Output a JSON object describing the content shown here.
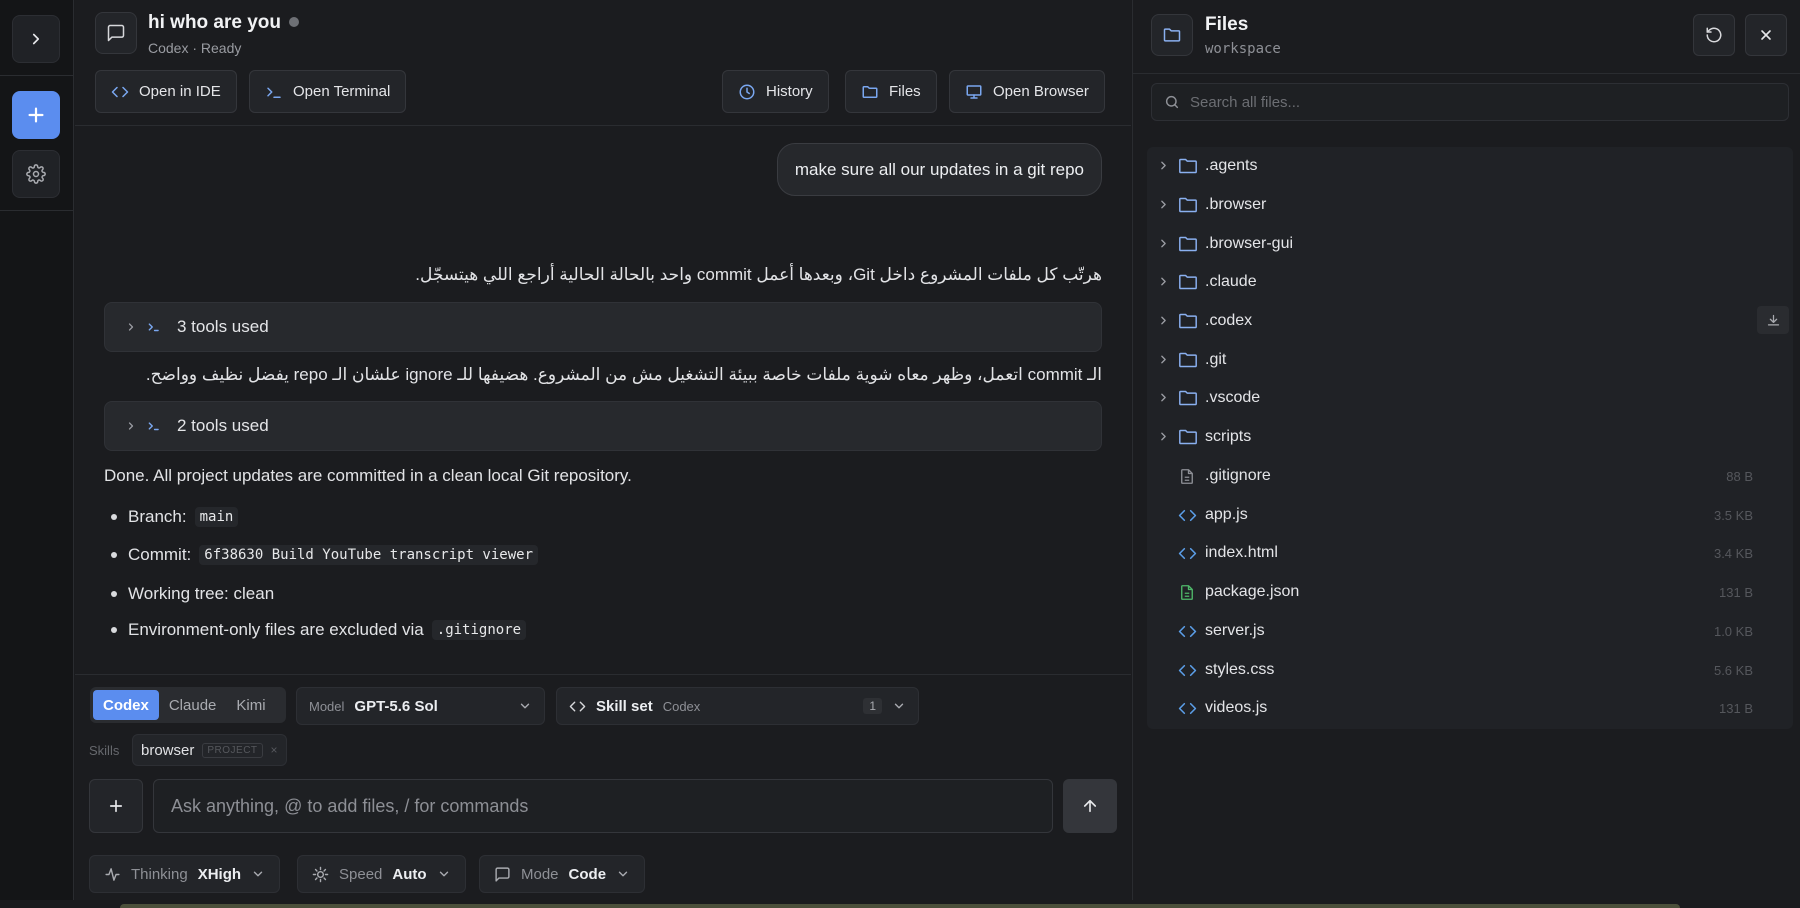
{
  "header": {
    "title": "hi who are you",
    "subtitle": "Codex · Ready",
    "buttons": {
      "open_ide": "Open in IDE",
      "open_terminal": "Open Terminal",
      "history": "History",
      "files": "Files",
      "open_browser": "Open Browser"
    }
  },
  "chat": {
    "user_message": "make sure all our updates in a git repo",
    "para1": "هرتّب كل ملفات المشروع داخل Git، وبعدها أعمل commit واحد بالحالة الحالية أراجع اللي هيتسجّل.",
    "tools1": "3 tools used",
    "para2": "الـ commit اتعمل، وظهر معاه شوية ملفات خاصة ببيئة التشغيل مش من المشروع. هضيفها للـ ignore علشان الـ repo يفضل نظيف وواضح.",
    "tools2": "2 tools used",
    "done": "Done. All project updates are committed in a clean local Git repository.",
    "bullets": {
      "branch_label": "Branch:",
      "branch_value": "main",
      "commit_label": "Commit:",
      "commit_value": "6f38630 Build YouTube transcript viewer",
      "tree": "Working tree: clean",
      "env_label": "Environment-only files are excluded via",
      "env_value": ".gitignore"
    }
  },
  "composer": {
    "agents": [
      "Codex",
      "Claude",
      "Kimi"
    ],
    "active_agent": "Codex",
    "model_label": "Model",
    "model_value": "GPT-5.6 Sol",
    "skillset_label": "Skill set",
    "skillset_value": "Codex",
    "skillset_count": "1",
    "skills_label": "Skills",
    "skill_name": "browser",
    "skill_tag": "PROJECT",
    "skill_remove": "×",
    "input_placeholder": "Ask anything, @ to add files, / for commands",
    "thinking_label": "Thinking",
    "thinking_value": "XHigh",
    "speed_label": "Speed",
    "speed_value": "Auto",
    "mode_label": "Mode",
    "mode_value": "Code"
  },
  "files": {
    "title": "Files",
    "subtitle": "workspace",
    "search_placeholder": "Search all files...",
    "entries": [
      {
        "name": ".agents",
        "type": "folder",
        "size": ""
      },
      {
        "name": ".browser",
        "type": "folder",
        "size": ""
      },
      {
        "name": ".browser-gui",
        "type": "folder",
        "size": ""
      },
      {
        "name": ".claude",
        "type": "folder",
        "size": ""
      },
      {
        "name": ".codex",
        "type": "folder",
        "size": ""
      },
      {
        "name": ".git",
        "type": "folder",
        "size": ""
      },
      {
        "name": ".vscode",
        "type": "folder",
        "size": ""
      },
      {
        "name": "scripts",
        "type": "folder",
        "size": ""
      },
      {
        "name": ".gitignore",
        "type": "file",
        "size": "88 B"
      },
      {
        "name": "app.js",
        "type": "code",
        "size": "3.5 KB"
      },
      {
        "name": "index.html",
        "type": "code",
        "size": "3.4 KB"
      },
      {
        "name": "package.json",
        "type": "json",
        "size": "131 B"
      },
      {
        "name": "server.js",
        "type": "code",
        "size": "1.0 KB"
      },
      {
        "name": "styles.css",
        "type": "code",
        "size": "5.6 KB"
      },
      {
        "name": "videos.js",
        "type": "code",
        "size": "131 B"
      }
    ]
  },
  "colors": {
    "accent": "#5b8def",
    "code_icon": "#5b9ee8",
    "json_icon": "#4fb86a",
    "folder_icon": "#8ab0f0"
  }
}
